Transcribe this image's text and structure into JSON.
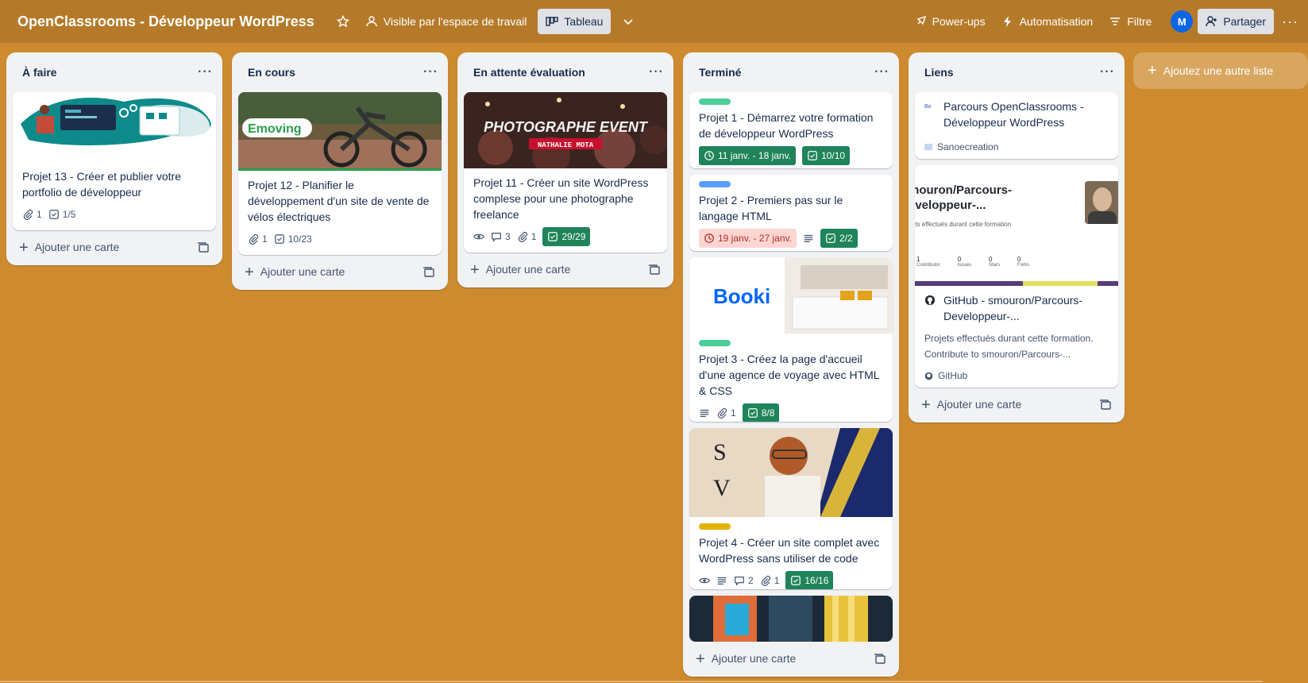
{
  "header": {
    "board_title": "OpenClassrooms - Développeur WordPress",
    "visibility": "Visible par l'espace de travail",
    "view": "Tableau",
    "powerups": "Power-ups",
    "automation": "Automatisation",
    "filter": "Filtre",
    "avatar_initial": "M",
    "share": "Partager"
  },
  "add_card_label": "Ajouter une carte",
  "add_list_label": "Ajoutez une autre liste",
  "lists": [
    {
      "title": "À faire",
      "cards": [
        {
          "title": "Projet 13 - Créer et publier votre portfolio de développeur",
          "attachments": "1",
          "checklist": "1/5"
        }
      ]
    },
    {
      "title": "En cours",
      "cards": [
        {
          "title": "Projet 12 - Planifier le développement d'un site de vente de vélos électriques",
          "cover_text": "Emoving",
          "attachments": "1",
          "checklist": "10/23"
        }
      ]
    },
    {
      "title": "En attente évaluation",
      "cards": [
        {
          "title": "Projet 11 - Créer un site WordPress complese pour une photographe freelance",
          "cover_text": "PHOTOGRAPHE EVENT",
          "cover_sub": "NATHALIE MOTA",
          "comments": "3",
          "attachments": "1",
          "checklist": "29/29"
        }
      ]
    },
    {
      "title": "Terminé",
      "cards": [
        {
          "title": "Projet 1 - Démarrez votre formation de développeur WordPress",
          "label_color": "#4bce97",
          "dates": "11 janv. - 18 janv.",
          "checklist": "10/10"
        },
        {
          "title": "Projet 2 - Premiers pas sur le langage HTML",
          "label_color": "#579dff",
          "dates": "19 janv. - 27 janv.",
          "checklist": "2/2"
        },
        {
          "title": "Projet 3 - Créez la page d'accueil d'une agence de voyage avec HTML & CSS",
          "label_color": "#4bce97",
          "cover_text": "Booki",
          "attachments": "1",
          "checklist": "8/8"
        },
        {
          "title": "Projet 4 - Créer un site complet avec WordPress sans utiliser de code",
          "label_color": "#e2b203",
          "comments": "2",
          "attachments": "1",
          "checklist": "16/16"
        }
      ]
    },
    {
      "title": "Liens",
      "cards": [
        {
          "title": "Parcours OpenClassrooms - Développeur WordPress",
          "source": "Sanoecreation"
        },
        {
          "title": "GitHub - smouron/Parcours-Developpeur-...",
          "description": "Projets effectués durant cette formation. Contribute to smouron/Parcours-...",
          "source": "GitHub",
          "preview_title": "mouron/Parcours-\neveloppeur-...",
          "preview_sub": "jets effectués durant cette formation",
          "preview_stats": [
            "1",
            "0",
            "0",
            "0"
          ],
          "preview_stat_labels": [
            "Contributor",
            "Issues",
            "Stars",
            "Forks"
          ]
        }
      ]
    }
  ],
  "colors": {
    "board_bg": "#cd8a2e",
    "header_bg": "#b57a29",
    "badge_green": "#1f845a",
    "badge_red": "#ffd5d2"
  }
}
